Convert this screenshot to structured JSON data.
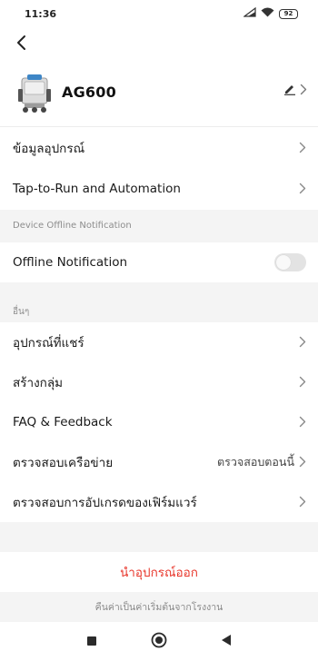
{
  "status_bar": {
    "time": "11:36",
    "battery": "92"
  },
  "device": {
    "name": "AG600"
  },
  "rows": {
    "device_info": "ข้อมูลอุปกรณ์",
    "tap_to_run": "Tap-to-Run and Automation",
    "offline_notification": "Offline Notification",
    "shared_devices": "อุปกรณ์ที่แชร์",
    "create_group": "สร้างกลุ่ม",
    "faq": "FAQ & Feedback",
    "network_check": "ตรวจสอบเครือข่าย",
    "network_check_value": "ตรวจสอบตอนนี้",
    "firmware_check": "ตรวจสอบการอัปเกรดของเฟิร์มแวร์"
  },
  "sections": {
    "offline_notification": "Device Offline Notification",
    "other": "อื่นๆ"
  },
  "toggles": {
    "offline_notification": false
  },
  "actions": {
    "remove_device": "นำอุปกรณ์ออก",
    "factory_reset": "คืนค่าเป็นค่าเริ่มต้นจากโรงงาน"
  },
  "colors": {
    "danger": "#e8362b",
    "toggle_off": "#e3e3e3",
    "section_bg": "#f4f4f4"
  }
}
